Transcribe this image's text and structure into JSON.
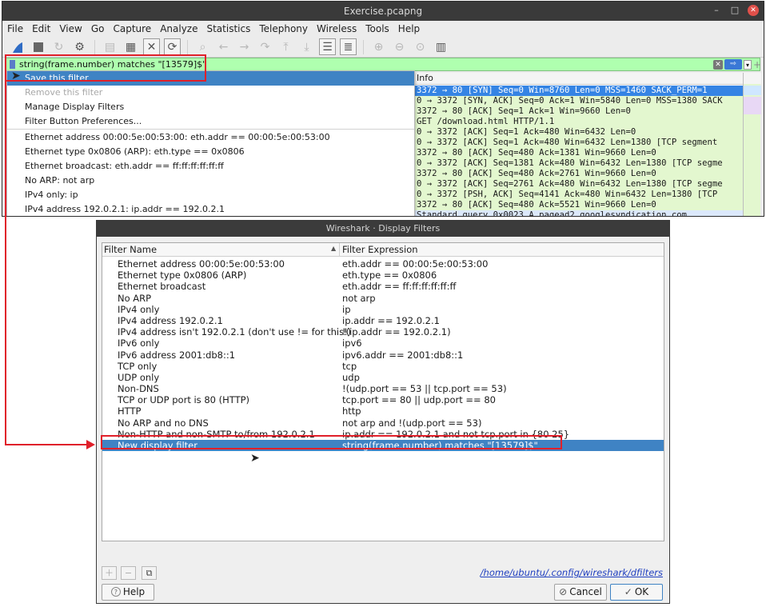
{
  "main_window": {
    "title": "Exercise.pcapng",
    "menu": [
      "File",
      "Edit",
      "View",
      "Go",
      "Capture",
      "Analyze",
      "Statistics",
      "Telephony",
      "Wireless",
      "Tools",
      "Help"
    ],
    "filter_text": "string(frame.number) matches \"[13579]$\"",
    "packet_column_header": "Info",
    "packet_rows": [
      "3372 → 80 [SYN] Seq=0 Win=8760 Len=0 MSS=1460 SACK_PERM=1",
      "0 → 3372 [SYN, ACK] Seq=0 Ack=1 Win=5840 Len=0 MSS=1380 SACK",
      "3372 → 80 [ACK] Seq=1 Ack=1 Win=9660 Len=0",
      "GET /download.html HTTP/1.1",
      "0 → 3372 [ACK] Seq=1 Ack=480 Win=6432 Len=0",
      "0 → 3372 [ACK] Seq=1 Ack=480 Win=6432 Len=1380 [TCP segment",
      "3372 → 80 [ACK] Seq=480 Ack=1381 Win=9660 Len=0",
      "0 → 3372 [ACK] Seq=1381 Ack=480 Win=6432 Len=1380 [TCP segme",
      "3372 → 80 [ACK] Seq=480 Ack=2761 Win=9660 Len=0",
      "0 → 3372 [ACK] Seq=2761 Ack=480 Win=6432 Len=1380 [TCP segme",
      "0 → 3372 [PSH, ACK] Seq=4141 Ack=480 Win=6432 Len=1380 [TCP",
      "3372 → 80 [ACK] Seq=480 Ack=5521 Win=9660 Len=0",
      "Standard query 0x0023 A pagead2.googlesyndication.com"
    ]
  },
  "dropdown_menu": {
    "items": [
      {
        "label": "Save this filter",
        "state": "active"
      },
      {
        "label": "Remove this filter",
        "state": "disabled"
      },
      {
        "label": "Manage Display Filters",
        "state": "normal"
      },
      {
        "label": "Filter Button Preferences...",
        "state": "normal"
      },
      {
        "label": "Ethernet address 00:00:5e:00:53:00: eth.addr == 00:00:5e:00:53:00",
        "state": "normal"
      },
      {
        "label": "Ethernet type 0x0806 (ARP): eth.type == 0x0806",
        "state": "normal"
      },
      {
        "label": "Ethernet broadcast: eth.addr == ff:ff:ff:ff:ff:ff",
        "state": "normal"
      },
      {
        "label": "No ARP: not arp",
        "state": "normal"
      },
      {
        "label": "IPv4 only: ip",
        "state": "normal"
      },
      {
        "label": "IPv4 address 192.0.2.1: ip.addr == 192.0.2.1",
        "state": "normal"
      }
    ]
  },
  "dialog": {
    "title": "Wireshark · Display Filters",
    "col_name": "Filter Name",
    "col_expr": "Filter Expression",
    "rows": [
      {
        "name": "Ethernet address 00:00:5e:00:53:00",
        "expr": "eth.addr == 00:00:5e:00:53:00"
      },
      {
        "name": "Ethernet type 0x0806 (ARP)",
        "expr": "eth.type == 0x0806"
      },
      {
        "name": "Ethernet broadcast",
        "expr": "eth.addr == ff:ff:ff:ff:ff:ff"
      },
      {
        "name": "No ARP",
        "expr": "not arp"
      },
      {
        "name": "IPv4 only",
        "expr": "ip"
      },
      {
        "name": "IPv4 address 192.0.2.1",
        "expr": "ip.addr == 192.0.2.1"
      },
      {
        "name": "IPv4 address isn't 192.0.2.1 (don't use != for this!)",
        "expr": "!(ip.addr == 192.0.2.1)"
      },
      {
        "name": "IPv6 only",
        "expr": "ipv6"
      },
      {
        "name": "IPv6 address 2001:db8::1",
        "expr": "ipv6.addr == 2001:db8::1"
      },
      {
        "name": "TCP only",
        "expr": "tcp"
      },
      {
        "name": "UDP only",
        "expr": "udp"
      },
      {
        "name": "Non-DNS",
        "expr": "!(udp.port == 53 || tcp.port == 53)"
      },
      {
        "name": "TCP or UDP port is 80 (HTTP)",
        "expr": "tcp.port == 80 || udp.port == 80"
      },
      {
        "name": "HTTP",
        "expr": "http"
      },
      {
        "name": "No ARP and no DNS",
        "expr": "not arp and !(udp.port == 53)"
      },
      {
        "name": "Non-HTTP and non-SMTP to/from 192.0.2.1",
        "expr": "ip.addr == 192.0.2.1 and not tcp.port in {80 25}"
      },
      {
        "name": "New display filter",
        "expr": "string(frame.number) matches \"[13579]$\""
      }
    ],
    "selected_index": 16,
    "path": "/home/ubuntu/.config/wireshark/dfilters",
    "help_label": "Help",
    "cancel_label": "Cancel",
    "ok_label": "OK"
  },
  "colors": {
    "highlight": "#e0202a",
    "selection": "#3f83c4",
    "filter_ok_bg": "#afffaf"
  }
}
